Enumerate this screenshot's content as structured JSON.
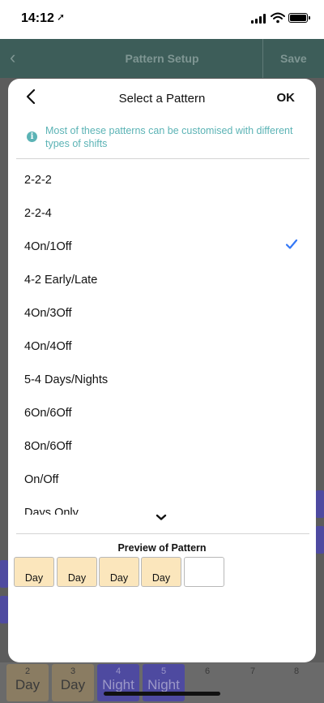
{
  "status_bar": {
    "time": "14:12"
  },
  "app_header": {
    "title": "Pattern Setup",
    "save_label": "Save"
  },
  "modal": {
    "title": "Select a Pattern",
    "ok_label": "OK",
    "info_text": "Most of these patterns can be customised with different types of shifts",
    "patterns": [
      {
        "label": "2-2-2",
        "selected": false
      },
      {
        "label": "2-2-4",
        "selected": false
      },
      {
        "label": "4On/1Off",
        "selected": true
      },
      {
        "label": "4-2 Early/Late",
        "selected": false
      },
      {
        "label": "4On/3Off",
        "selected": false
      },
      {
        "label": "4On/4Off",
        "selected": false
      },
      {
        "label": "5-4 Days/Nights",
        "selected": false
      },
      {
        "label": "6On/6Off",
        "selected": false
      },
      {
        "label": "8On/6Off",
        "selected": false
      },
      {
        "label": "On/Off",
        "selected": false
      },
      {
        "label": "Days Only",
        "selected": false
      }
    ],
    "preview_title": "Preview of Pattern",
    "preview": [
      "Day",
      "Day",
      "Day",
      "Day",
      ""
    ]
  },
  "calendar_strip": [
    {
      "num": "2",
      "label": "Day",
      "type": "day"
    },
    {
      "num": "3",
      "label": "Day",
      "type": "day"
    },
    {
      "num": "4",
      "label": "Night",
      "type": "night"
    },
    {
      "num": "5",
      "label": "Night",
      "type": "night"
    },
    {
      "num": "6",
      "label": "",
      "type": "blank"
    },
    {
      "num": "7",
      "label": "",
      "type": "blank"
    },
    {
      "num": "8",
      "label": "",
      "type": "blank"
    }
  ],
  "colors": {
    "accent": "#3478f6",
    "info": "#5bb3b5",
    "day": "#fbe6bc",
    "night": "#4e4aa0",
    "header": "#3d5d59"
  },
  "icons": {
    "back": "chevron-left-icon",
    "check": "checkmark-icon",
    "info": "info-icon",
    "more": "chevron-down-icon"
  }
}
